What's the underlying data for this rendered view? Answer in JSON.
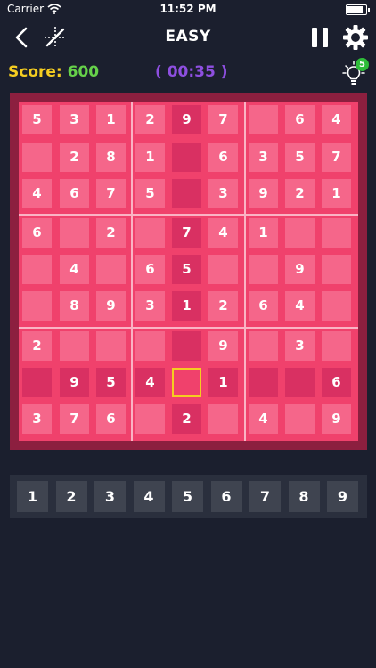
{
  "status_bar": {
    "carrier": "Carrier",
    "time": "11:52 PM"
  },
  "header": {
    "title": "EASY"
  },
  "score": {
    "label": "Score: ",
    "value": "600"
  },
  "timer": {
    "text": "( 00:35 )"
  },
  "hints": {
    "count": "5"
  },
  "colors": {
    "board": "#f0416c",
    "cell": "#f5668a",
    "cell_highlight": "#d93062",
    "frame": "#8c1f3f",
    "score_label": "#f5cd21",
    "score_value": "#66d14a",
    "timer": "#8e4fe0",
    "selected_border": "#f5cd21"
  },
  "grid": [
    [
      "5",
      "3",
      "1",
      "2",
      "9",
      "7",
      "",
      "6",
      "4"
    ],
    [
      "",
      "2",
      "8",
      "1",
      "",
      "6",
      "3",
      "5",
      "7"
    ],
    [
      "4",
      "6",
      "7",
      "5",
      "",
      "3",
      "9",
      "2",
      "1"
    ],
    [
      "6",
      "",
      "2",
      "",
      "7",
      "4",
      "1",
      "",
      ""
    ],
    [
      "",
      "4",
      "",
      "6",
      "5",
      "",
      "",
      "9",
      ""
    ],
    [
      "",
      "8",
      "9",
      "3",
      "1",
      "2",
      "6",
      "4",
      ""
    ],
    [
      "2",
      "",
      "",
      "",
      "",
      "9",
      "",
      "3",
      ""
    ],
    [
      "",
      "9",
      "5",
      "4",
      "",
      "1",
      "",
      "",
      "6"
    ],
    [
      "3",
      "7",
      "6",
      "",
      "2",
      "",
      "4",
      "",
      "9"
    ]
  ],
  "highlighted_cells": [
    [
      0,
      4
    ],
    [
      1,
      4
    ],
    [
      2,
      4
    ],
    [
      3,
      4
    ],
    [
      4,
      4
    ],
    [
      5,
      4
    ],
    [
      6,
      4
    ],
    [
      8,
      4
    ],
    [
      7,
      0
    ],
    [
      7,
      1
    ],
    [
      7,
      2
    ],
    [
      7,
      3
    ],
    [
      7,
      5
    ],
    [
      7,
      6
    ],
    [
      7,
      7
    ],
    [
      7,
      8
    ]
  ],
  "selected_cell": [
    7,
    4
  ],
  "number_pad": [
    "1",
    "2",
    "3",
    "4",
    "5",
    "6",
    "7",
    "8",
    "9"
  ]
}
